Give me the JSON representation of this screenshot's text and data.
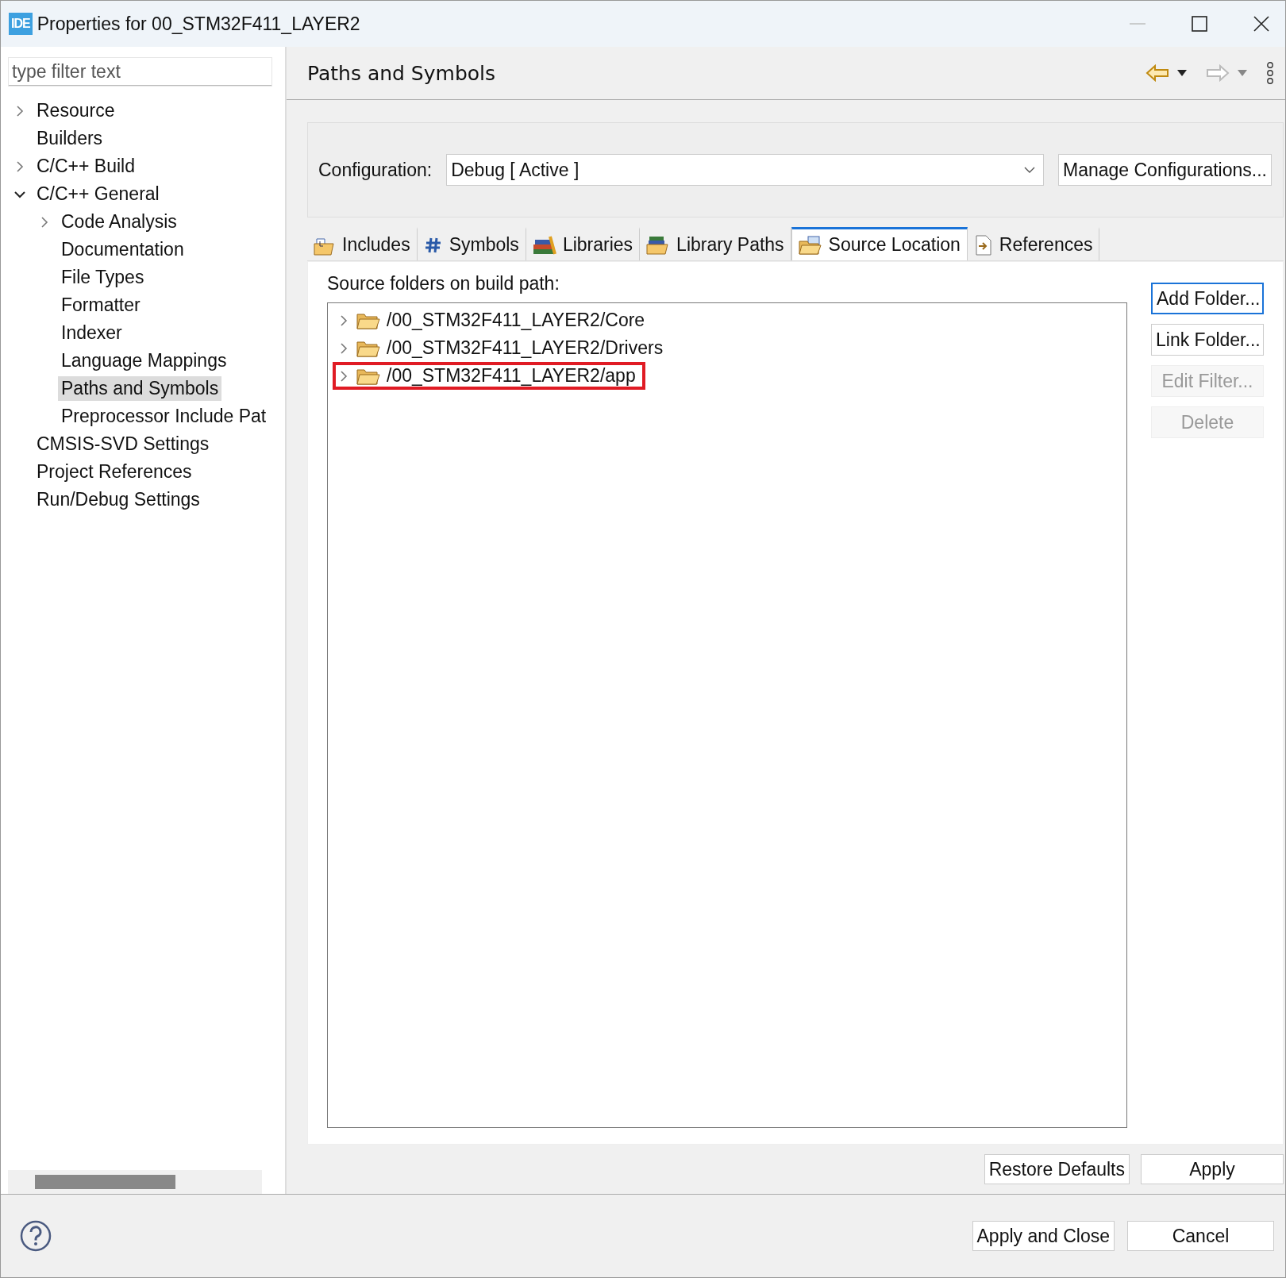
{
  "window": {
    "app_badge": "IDE",
    "title": "Properties for 00_STM32F411_LAYER2"
  },
  "filter": {
    "placeholder": "type filter text"
  },
  "nav": [
    {
      "label": "Resource",
      "expanded": false,
      "selected": false
    },
    {
      "label": "Builders",
      "selected": false
    },
    {
      "label": "C/C++ Build",
      "expanded": false,
      "selected": false
    },
    {
      "label": "C/C++ General",
      "expanded": true,
      "selected": false,
      "children": [
        {
          "label": "Code Analysis",
          "expanded": false,
          "selected": false
        },
        {
          "label": "Documentation",
          "selected": false
        },
        {
          "label": "File Types",
          "selected": false
        },
        {
          "label": "Formatter",
          "selected": false
        },
        {
          "label": "Indexer",
          "selected": false
        },
        {
          "label": "Language Mappings",
          "selected": false
        },
        {
          "label": "Paths and Symbols",
          "selected": true
        },
        {
          "label": "Preprocessor Include Pat",
          "selected": false
        }
      ]
    },
    {
      "label": "CMSIS-SVD Settings",
      "selected": false
    },
    {
      "label": "Project References",
      "selected": false
    },
    {
      "label": "Run/Debug Settings",
      "selected": false
    }
  ],
  "page": {
    "title": "Paths and Symbols"
  },
  "configuration": {
    "label": "Configuration:",
    "value": "Debug  [ Active ]",
    "manage_button": "Manage Configurations..."
  },
  "tabs": [
    {
      "label": "Includes",
      "kind": "includes",
      "selected": false
    },
    {
      "label": "Symbols",
      "kind": "symbols",
      "selected": false
    },
    {
      "label": "Libraries",
      "kind": "libraries",
      "selected": false
    },
    {
      "label": "Library Paths",
      "kind": "library-paths",
      "selected": false
    },
    {
      "label": "Source Location",
      "kind": "source",
      "selected": true
    },
    {
      "label": "References",
      "kind": "references",
      "selected": false
    }
  ],
  "source_folders": {
    "label": "Source folders on build path:",
    "items": [
      {
        "path": "/00_STM32F411_LAYER2/Core",
        "highlighted": false
      },
      {
        "path": "/00_STM32F411_LAYER2/Drivers",
        "highlighted": false
      },
      {
        "path": "/00_STM32F411_LAYER2/app",
        "highlighted": true
      }
    ],
    "buttons": [
      {
        "label": "Add Folder...",
        "disabled": false,
        "focused": true
      },
      {
        "label": "Link Folder...",
        "disabled": false,
        "focused": false
      },
      {
        "label": "Edit Filter...",
        "disabled": true,
        "focused": false
      },
      {
        "label": "Delete",
        "disabled": true,
        "focused": false
      }
    ]
  },
  "page_buttons": [
    "Restore Defaults",
    "Apply"
  ],
  "dialog_buttons": [
    "Apply and Close",
    "Cancel"
  ]
}
